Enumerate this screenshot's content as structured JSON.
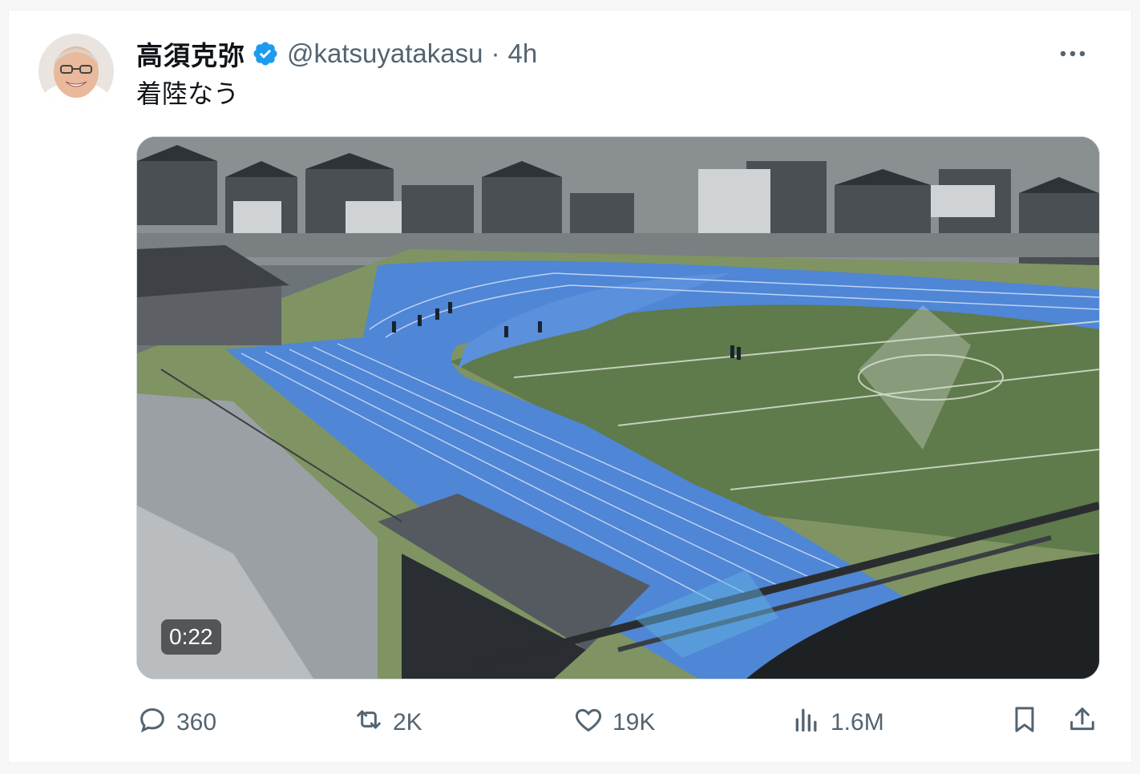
{
  "tweet": {
    "author_name": "高須克弥",
    "handle": "@katsuyatakasu",
    "separator": "·",
    "time": "4h",
    "text": "着陸なう",
    "verified_icon": "verified-badge-icon",
    "more_icon": "more-icon"
  },
  "media": {
    "type": "video",
    "duration": "0:22"
  },
  "actions": {
    "replies": "360",
    "reposts": "2K",
    "likes": "19K",
    "views": "1.6M"
  },
  "colors": {
    "verified": "#1d9bf0",
    "secondary_text": "#536471",
    "track_blue": "#4f86d6",
    "field_green": "#5f7a4b"
  }
}
